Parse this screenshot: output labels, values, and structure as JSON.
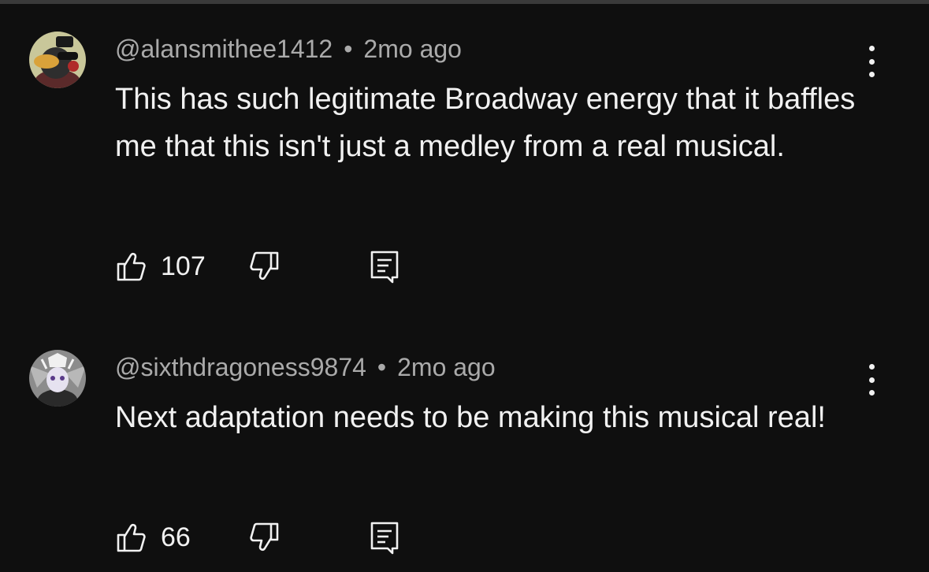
{
  "comments": [
    {
      "author": "@alansmithee1412",
      "separator": "•",
      "time": "2mo ago",
      "text": "This has such legitimate Broadway energy that it baffles me that this isn't just a medley from a real musical.",
      "likes": "107",
      "avatar_icon": "duck-avatar-icon"
    },
    {
      "author": "@sixthdragoness9874",
      "separator": "•",
      "time": "2mo ago",
      "text": "Next adaptation needs to be making this musical real!",
      "likes": "66",
      "avatar_icon": "dragon-character-avatar-icon"
    }
  ],
  "icons": {
    "like": "thumbs-up-icon",
    "dislike": "thumbs-down-icon",
    "reply": "reply-comment-icon",
    "menu": "more-vertical-icon"
  },
  "colors": {
    "background": "#0f0f0f",
    "text": "#f1f1f1",
    "secondary": "#aaaaaa"
  }
}
